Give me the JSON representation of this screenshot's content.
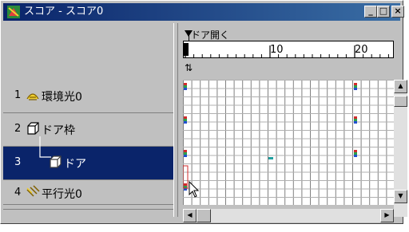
{
  "window": {
    "title": "スコア - スコア0"
  },
  "titlebar_buttons": [
    {
      "name": "minimize",
      "glyph": "_"
    },
    {
      "name": "maximize",
      "glyph": "□"
    },
    {
      "name": "close",
      "glyph": "×"
    }
  ],
  "ruler": {
    "marker_label": "ドア開く",
    "current_frame": "0",
    "labels": [
      "10",
      "20"
    ],
    "loop_glyph": "⇅"
  },
  "tracks": [
    {
      "num": "1",
      "name": "環境光0",
      "icon": "ambient-light-icon",
      "selected": false
    },
    {
      "num": "2",
      "name": "ドア枠",
      "icon": "cube-icon",
      "selected": false
    },
    {
      "num": "3",
      "name": "ドア",
      "icon": "cube-icon",
      "selected": true
    },
    {
      "num": "4",
      "name": "平行光0",
      "icon": "directional-light-icon",
      "selected": false
    }
  ],
  "colors": {
    "titlebar_start": "#0a246a",
    "titlebar_end": "#3a6ea5",
    "selection": "#0a246a",
    "key_red": "#d22b2b",
    "key_green": "#2aa04a",
    "key_blue": "#2050d0",
    "key_teal": "#20a0a0"
  },
  "scroll_glyphs": {
    "up": "▲",
    "down": "▼",
    "left": "◀",
    "right": "▶"
  }
}
